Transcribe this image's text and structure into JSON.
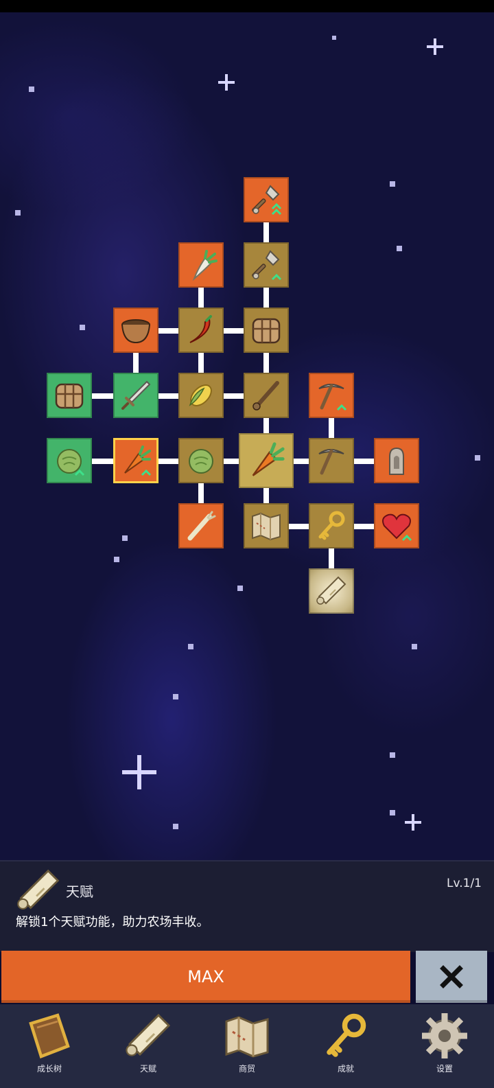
{
  "tree": {
    "nodes": [
      {
        "id": "shovel-upgrade-2",
        "icon": "shovel-icon",
        "style": "orange",
        "upgrade": true
      },
      {
        "id": "radish",
        "icon": "radish-icon",
        "style": "orange",
        "upgrade": false
      },
      {
        "id": "shovel-upgrade-1",
        "icon": "shovel-icon",
        "style": "gold",
        "upgrade": true
      },
      {
        "id": "bowl",
        "icon": "bowl-icon",
        "style": "orange",
        "upgrade": false
      },
      {
        "id": "chili",
        "icon": "chili-icon",
        "style": "gold",
        "upgrade": false
      },
      {
        "id": "crate-gold",
        "icon": "crate-icon",
        "style": "gold",
        "upgrade": false
      },
      {
        "id": "crate-green",
        "icon": "crate-icon",
        "style": "green",
        "upgrade": false
      },
      {
        "id": "sword",
        "icon": "sword-icon",
        "style": "green",
        "upgrade": false
      },
      {
        "id": "corn",
        "icon": "corn-icon",
        "style": "gold",
        "upgrade": false
      },
      {
        "id": "flute",
        "icon": "flute-icon",
        "style": "gold",
        "upgrade": false
      },
      {
        "id": "pickaxe-upgrade",
        "icon": "pickaxe-icon",
        "style": "orange",
        "upgrade": true
      },
      {
        "id": "cabbage-green",
        "icon": "cabbage-icon",
        "style": "green",
        "upgrade": true
      },
      {
        "id": "carrot-highlight",
        "icon": "carrot-icon",
        "style": "orange",
        "upgrade": true
      },
      {
        "id": "cabbage-gold",
        "icon": "cabbage-icon",
        "style": "gold",
        "upgrade": false
      },
      {
        "id": "carrot-root",
        "icon": "carrot-icon",
        "style": "selected",
        "upgrade": false
      },
      {
        "id": "pickaxe",
        "icon": "pickaxe-icon",
        "style": "gold",
        "upgrade": false
      },
      {
        "id": "statue",
        "icon": "statue-icon",
        "style": "orange",
        "upgrade": false
      },
      {
        "id": "leek",
        "icon": "leek-icon",
        "style": "orange",
        "upgrade": false
      },
      {
        "id": "map",
        "icon": "map-icon",
        "style": "gold",
        "upgrade": false
      },
      {
        "id": "key",
        "icon": "key-icon",
        "style": "gold",
        "upgrade": false
      },
      {
        "id": "heart",
        "icon": "heart-icon",
        "style": "orange",
        "upgrade": true
      },
      {
        "id": "scroll-talent",
        "icon": "scroll-icon",
        "style": "glow",
        "upgrade": false
      }
    ]
  },
  "panel": {
    "icon": "scroll-icon",
    "title": "天赋",
    "level": "Lv.1/1",
    "description": "解锁1个天赋功能，助力农场丰收。"
  },
  "actions": {
    "max_label": "MAX",
    "close_icon": "close-icon"
  },
  "nav": {
    "items": [
      {
        "label": "成长树",
        "icon": "book-icon"
      },
      {
        "label": "天赋",
        "icon": "scroll-icon"
      },
      {
        "label": "商贸",
        "icon": "map-icon"
      },
      {
        "label": "成就",
        "icon": "key-icon"
      },
      {
        "label": "设置",
        "icon": "gear-icon"
      }
    ]
  },
  "colors": {
    "orange_node": "#e4662a",
    "gold_node": "#a7863c",
    "green_node": "#43b46a",
    "max_button": "#e36528",
    "close_button": "#a9b6c4",
    "panel_bg": "#1c1e33",
    "nav_bg": "#252941"
  }
}
